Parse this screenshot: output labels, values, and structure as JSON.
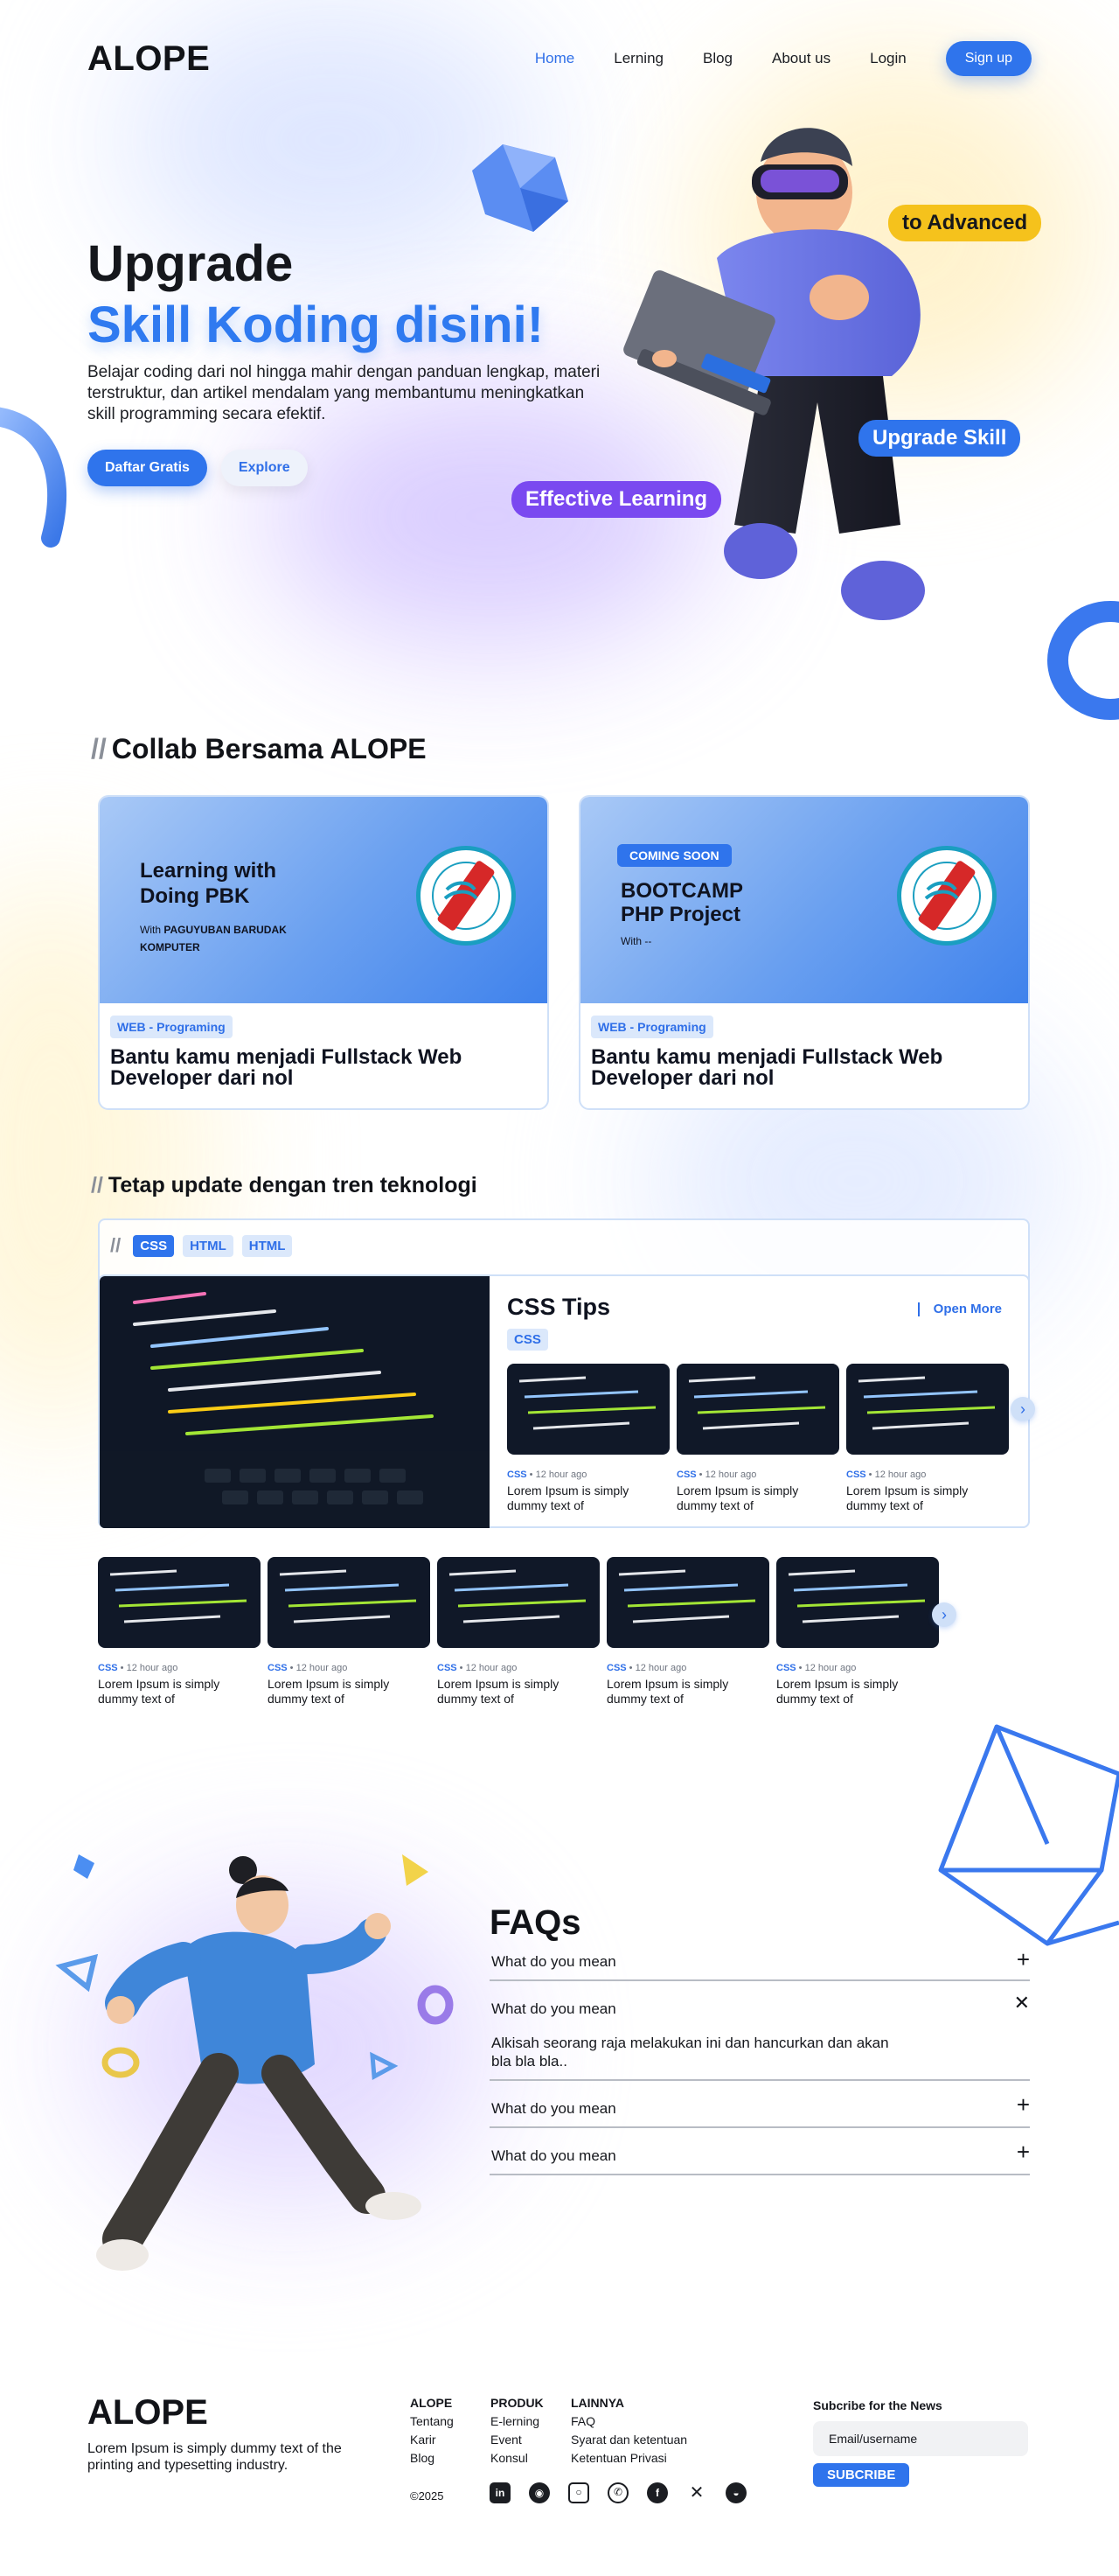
{
  "nav": {
    "logo": "ALOPE",
    "links": [
      "Home",
      "Lerning",
      "Blog",
      "About us",
      "Login"
    ],
    "signup": "Sign up"
  },
  "hero": {
    "title_line1": "Upgrade",
    "title_line2": "Skill Koding disini!",
    "description": "Belajar coding dari nol hingga mahir dengan panduan lengkap, materi terstruktur, dan artikel mendalam yang membantumu meningkatkan skill programming secara efektif.",
    "btn_primary": "Daftar Gratis",
    "btn_secondary": "Explore",
    "tag_advanced": "to Advanced",
    "tag_skill": "Upgrade Skill",
    "tag_effective": "Effective Learning"
  },
  "collab": {
    "slashes": "//",
    "title": "Collab Bersama ALOPE",
    "cards": [
      {
        "banner_title": "Learning with Doing PBK",
        "with_prefix": "With",
        "with_name": "PAGUYUBAN BARUDAK KOMPUTER",
        "category": "WEB - Programing",
        "title": "Bantu kamu menjadi Fullstack Web Developer dari nol"
      },
      {
        "badge": "COMING SOON",
        "banner_title": "BOOTCAMP PHP Project",
        "with_text": "With --",
        "category": "WEB - Programing",
        "title": "Bantu kamu menjadi Fullstack Web Developer dari nol"
      }
    ]
  },
  "trend": {
    "slashes": "//",
    "title": "Tetap update dengan tren teknologi",
    "chips": [
      "CSS",
      "HTML",
      "HTML"
    ],
    "tips_title": "CSS Tips",
    "tips_chip": "CSS",
    "open_more": "Open More",
    "items": [
      {
        "tag": "CSS",
        "time": "12 hour ago",
        "caption": "Lorem Ipsum is simply dummy text of"
      },
      {
        "tag": "CSS",
        "time": "12 hour ago",
        "caption": "Lorem Ipsum is simply dummy text of"
      },
      {
        "tag": "CSS",
        "time": "12 hour ago",
        "caption": "Lorem Ipsum is simply dummy text of"
      }
    ],
    "strip": [
      {
        "tag": "CSS",
        "time": "12 hour ago",
        "caption": "Lorem Ipsum is simply dummy text of"
      },
      {
        "tag": "CSS",
        "time": "12 hour ago",
        "caption": "Lorem Ipsum is simply dummy text of"
      },
      {
        "tag": "CSS",
        "time": "12 hour ago",
        "caption": "Lorem Ipsum is simply dummy text of"
      },
      {
        "tag": "CSS",
        "time": "12 hour ago",
        "caption": "Lorem Ipsum is simply dummy text of"
      },
      {
        "tag": "CSS",
        "time": "12 hour ago",
        "caption": "Lorem Ipsum is simply dummy text of"
      }
    ]
  },
  "faq": {
    "title": "FAQs",
    "items": [
      {
        "q": "What do you mean",
        "open": false
      },
      {
        "q": "What do you mean",
        "open": true,
        "a": "Alkisah seorang raja melakukan ini dan hancurkan dan akan bla bla bla.."
      },
      {
        "q": "What do you mean",
        "open": false
      },
      {
        "q": "What do you mean",
        "open": false
      }
    ]
  },
  "footer": {
    "logo": "ALOPE",
    "description": "Lorem Ipsum is simply dummy text of the printing and typesetting industry.",
    "col1": {
      "title": "ALOPE",
      "links": [
        "Tentang",
        "Karir",
        "Blog"
      ]
    },
    "col2": {
      "title": "PRODUK",
      "links": [
        "E-lerning",
        "Event",
        "Konsul"
      ]
    },
    "col3": {
      "title": "LAINNYA",
      "links": [
        "FAQ",
        "Syarat dan ketentuan",
        "Ketentuan Privasi"
      ]
    },
    "copyright": "©2025",
    "social": [
      "linkedin-icon",
      "discord-icon",
      "instagram-icon",
      "whatsapp-icon",
      "facebook-icon",
      "x-icon",
      "github-icon"
    ],
    "newsletter": {
      "title": "Subcribe for the News",
      "placeholder": "Email/username",
      "button": "SUBCRIBE"
    }
  },
  "colors": {
    "accent": "#2f74ec",
    "yellow": "#f5c21c",
    "purple": "#7a49f0"
  }
}
